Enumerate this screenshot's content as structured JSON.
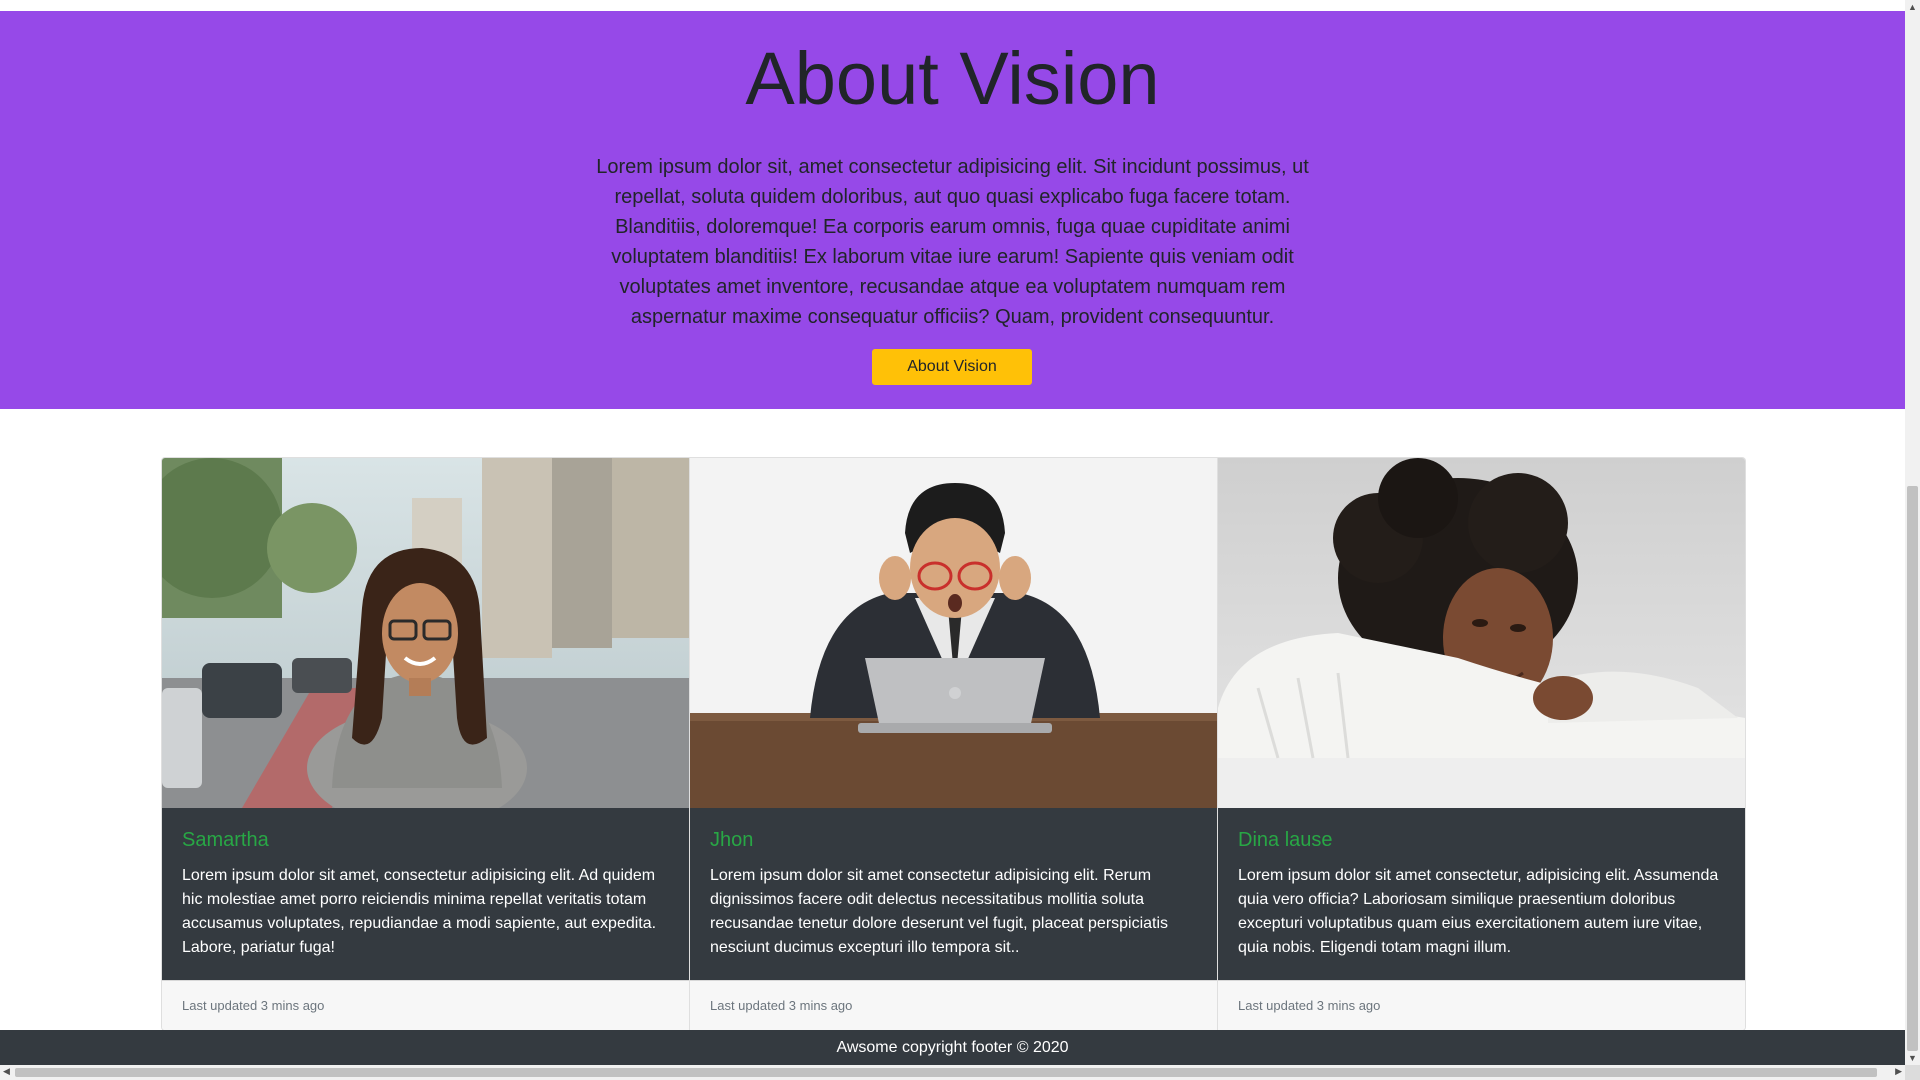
{
  "hero": {
    "title": "About Vision",
    "paragraph": "Lorem ipsum dolor sit, amet consectetur adipisicing elit. Sit incidunt possimus, ut repellat, soluta quidem doloribus, aut quo quasi explicabo fuga facere totam. Blanditiis, doloremque! Ea corporis earum omnis, fuga quae cupiditate animi voluptatem blanditiis! Ex laborum vitae iure earum! Sapiente quis veniam odit voluptates amet inventore, recusandae atque ea voluptatem numquam rem aspernatur maxime consequatur officiis? Quam, provident consequuntur.",
    "button_label": "About Vision",
    "background_color": "#9649e8",
    "button_color": "#ffc107"
  },
  "cards": [
    {
      "name": "Samartha",
      "text": "Lorem ipsum dolor sit amet, consectetur adipisicing elit. Ad quidem hic molestiae amet porro reiciendis minima repellat veritatis totam accusamus voluptates, repudiandae a modi sapiente, aut expedita. Labore, pariatur fuga!",
      "footer": "Last updated 3 mins ago"
    },
    {
      "name": "Jhon",
      "text": "Lorem ipsum dolor sit amet consectetur adipisicing elit. Rerum dignissimos facere odit delectus necessitatibus mollitia soluta recusandae tenetur dolore deserunt vel fugit, placeat perspiciatis nesciunt ducimus excepturi illo tempora sit..",
      "footer": "Last updated 3 mins ago"
    },
    {
      "name": "Dina lause",
      "text": "Lorem ipsum dolor sit amet consectetur, adipisicing elit. Assumenda quia vero officia? Laboriosam similique praesentium doloribus excepturi voluptatibus quam eius exercitationem autem iure vitae, quia nobis. Eligendi totam magni illum.",
      "footer": "Last updated 3 mins ago"
    }
  ],
  "footer": {
    "text": "Awsome copyright footer © 2020"
  },
  "colors": {
    "card_title": "#28a745",
    "card_body_bg": "#343a40"
  }
}
